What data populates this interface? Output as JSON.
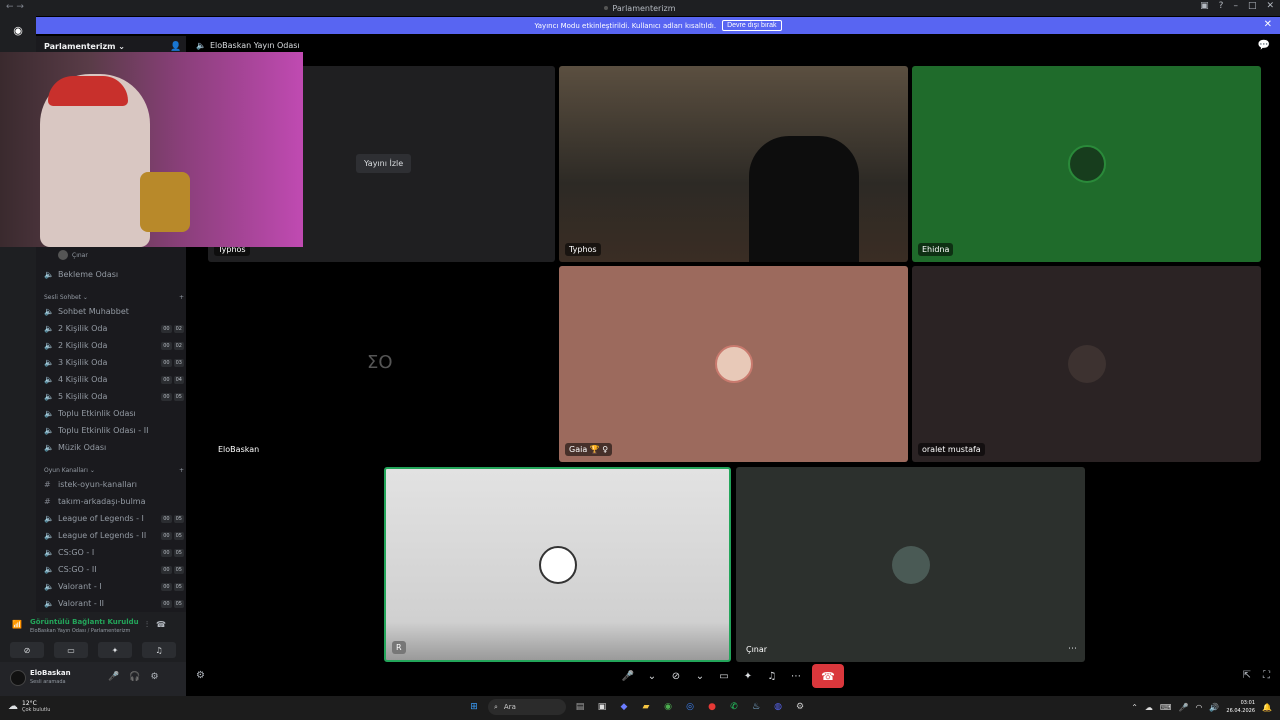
{
  "window": {
    "title": "Parlamenterizm"
  },
  "banner": {
    "message": "Yayıncı Modu etkinleştirildi. Kullanıcı adları kısaltıldı.",
    "button": "Devre dışı bırak"
  },
  "server": {
    "name": "Parlamenterizm ⌄"
  },
  "stage": {
    "title": "EloBaskan Yayın Odası"
  },
  "sidebar": {
    "sub_user": "Çınar",
    "waiting": "Bekleme Odası",
    "cat_voice": "Sesli Sohbet ⌄",
    "cat_games": "Oyun Kanalları ⌄",
    "voice": [
      {
        "name": "Sohbet Muhabbet",
        "icon": "🔊",
        "b1": "",
        "b2": ""
      },
      {
        "name": "2 Kişilik Oda",
        "icon": "🔊",
        "b1": "00",
        "b2": "02"
      },
      {
        "name": "2 Kişilik Oda",
        "icon": "🔊",
        "b1": "00",
        "b2": "02"
      },
      {
        "name": "3 Kişilik Oda",
        "icon": "🔊",
        "b1": "00",
        "b2": "03"
      },
      {
        "name": "4 Kişilik Oda",
        "icon": "🔊",
        "b1": "00",
        "b2": "04"
      },
      {
        "name": "5 Kişilik Oda",
        "icon": "🔊",
        "b1": "00",
        "b2": "05"
      },
      {
        "name": "Toplu Etkinlik Odası",
        "icon": "🔊",
        "b1": "",
        "b2": ""
      },
      {
        "name": "Toplu Etkinlik Odası - II",
        "icon": "🔊",
        "b1": "",
        "b2": ""
      },
      {
        "name": "Müzik Odası",
        "icon": "🔊",
        "b1": "",
        "b2": ""
      }
    ],
    "games": [
      {
        "name": "istek-oyun-kanalları",
        "icon": "#",
        "b1": "",
        "b2": ""
      },
      {
        "name": "takım-arkadaşı-bulma",
        "icon": "#",
        "b1": "",
        "b2": ""
      },
      {
        "name": "League of Legends - I",
        "icon": "🔊",
        "b1": "00",
        "b2": "05"
      },
      {
        "name": "League of Legends - II",
        "icon": "🔊",
        "b1": "00",
        "b2": "05"
      },
      {
        "name": "CS:GO - I",
        "icon": "🔊",
        "b1": "00",
        "b2": "05"
      },
      {
        "name": "CS:GO - II",
        "icon": "🔊",
        "b1": "00",
        "b2": "05"
      },
      {
        "name": "Valorant - I",
        "icon": "🔊",
        "b1": "00",
        "b2": "05"
      },
      {
        "name": "Valorant - II",
        "icon": "🔊",
        "b1": "00",
        "b2": "05"
      }
    ]
  },
  "voice_panel": {
    "title": "Görüntülü Bağlantı Kuruldu",
    "subtitle": "EloBaskan Yayın Odası / Parlamenterizm"
  },
  "user_panel": {
    "name": "EloBaskan",
    "status": "Sesli aramada"
  },
  "tiles": {
    "typhos_stream": {
      "label": "Typhos",
      "watch": "Yayını İzle"
    },
    "typhos": {
      "label": "Typhos"
    },
    "ehidna": {
      "label": "Ehidna"
    },
    "elobaskan": {
      "label": "EloBaskan"
    },
    "gaia": {
      "label": "Gaia 🏆 ♀"
    },
    "oralet": {
      "label": "oralet mustafa"
    },
    "unknown": {
      "label": "R"
    },
    "cinar": {
      "label": "Çınar"
    }
  },
  "taskbar": {
    "temp": "12°C",
    "weather": "Çok bulutlu",
    "search": "Ara",
    "time": "03:01",
    "date": "26.04.2026"
  },
  "colors": {
    "accent": "#5865f2",
    "end_call": "#da373c",
    "ehidna_bg": "#1f6b2b",
    "gaia_bg": "#9c6a5d",
    "connected": "#23a55a"
  }
}
